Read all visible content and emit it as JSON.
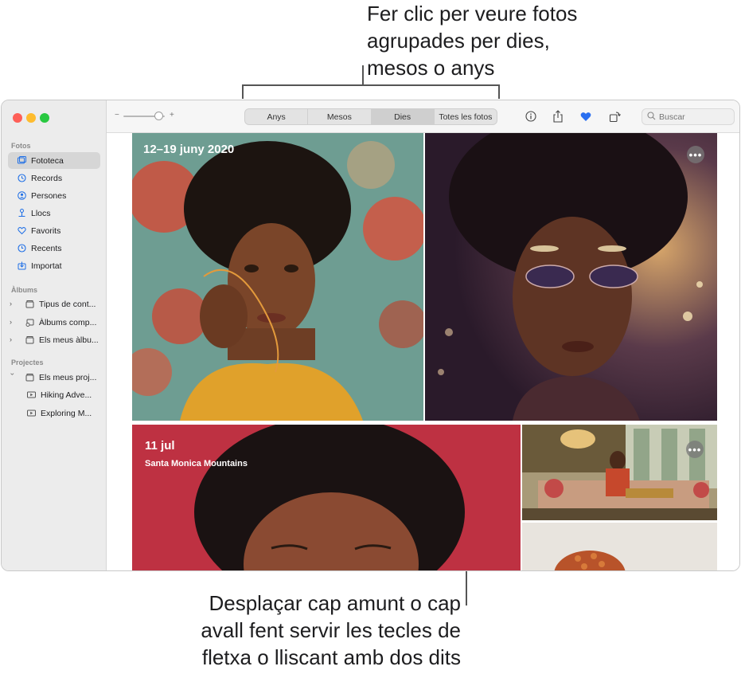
{
  "callouts": {
    "top": "Fer clic per veure fotos\nagrupades per dies,\nmesos o anys",
    "bottom": "Desplaçar cap amunt o cap\navall fent servir les tecles de\nfletxa o lliscant amb dos dits"
  },
  "sidebar": {
    "section_fotos": "Fotos",
    "items": [
      {
        "label": "Fototeca",
        "icon": "library-icon",
        "selected": true
      },
      {
        "label": "Records",
        "icon": "memories-icon"
      },
      {
        "label": "Persones",
        "icon": "people-icon"
      },
      {
        "label": "Llocs",
        "icon": "places-icon"
      },
      {
        "label": "Favorits",
        "icon": "heart-icon"
      },
      {
        "label": "Recents",
        "icon": "clock-icon"
      },
      {
        "label": "Importat",
        "icon": "import-icon"
      }
    ],
    "section_albums": "Àlbums",
    "albums": [
      {
        "label": "Tipus de cont..."
      },
      {
        "label": "Àlbums comp..."
      },
      {
        "label": "Els meus àlbu..."
      }
    ],
    "section_projects": "Projectes",
    "projects_folder": "Els meus proj...",
    "projects": [
      {
        "label": "Hiking Adve..."
      },
      {
        "label": "Exploring M..."
      }
    ]
  },
  "toolbar": {
    "zoom_minus": "−",
    "zoom_plus": "+",
    "zoom_level": 0.85,
    "segments": [
      "Anys",
      "Mesos",
      "Dies",
      "Totes les fotos"
    ],
    "active_segment": "Dies",
    "search_placeholder": "Buscar"
  },
  "content": {
    "group1_title": "12–19 juny 2020",
    "group2_title": "11 jul",
    "group2_subtitle": "Santa Monica Mountains",
    "more_label": "•••"
  },
  "colors": {
    "accent_blue": "#1f6fe6",
    "heart": "#2a6ff0"
  }
}
